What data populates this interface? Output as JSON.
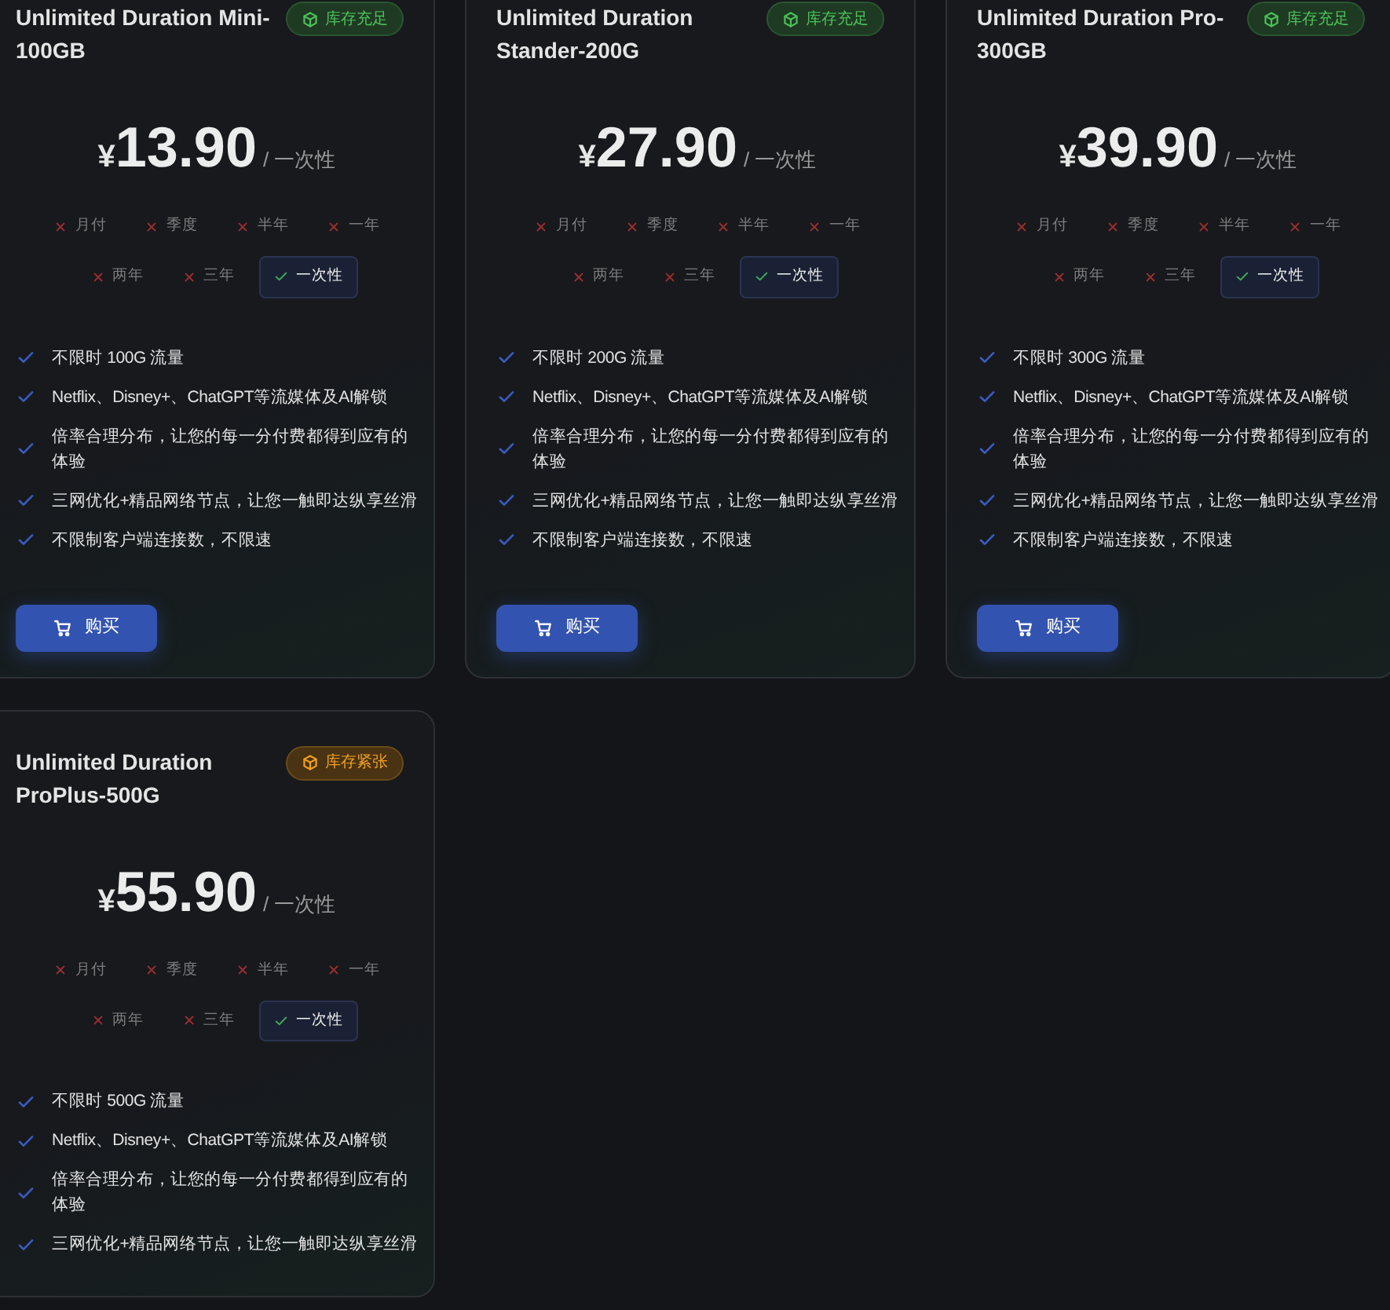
{
  "plans": [
    {
      "title": "Unlimited Duration Mini-100GB",
      "stock": {
        "kind": "ample",
        "label": "库存充足"
      },
      "currency": "¥",
      "price": "13.90",
      "per": "/ 一次性",
      "periods": [
        {
          "label": "月付",
          "available": false,
          "selected": false
        },
        {
          "label": "季度",
          "available": false,
          "selected": false
        },
        {
          "label": "半年",
          "available": false,
          "selected": false
        },
        {
          "label": "一年",
          "available": false,
          "selected": false
        },
        {
          "label": "两年",
          "available": false,
          "selected": false
        },
        {
          "label": "三年",
          "available": false,
          "selected": false
        },
        {
          "label": "一次性",
          "available": true,
          "selected": true
        }
      ],
      "features": [
        "不限时 100G 流量",
        "Netflix、Disney+、ChatGPT等流媒体及AI解锁",
        "倍率合理分布，让您的每一分付费都得到应有的体验",
        "三网优化+精品网络节点，让您一触即达纵享丝滑",
        "不限制客户端连接数，不限速"
      ],
      "button": "购买"
    },
    {
      "title": "Unlimited Duration Stander-200G",
      "stock": {
        "kind": "ample",
        "label": "库存充足"
      },
      "currency": "¥",
      "price": "27.90",
      "per": "/ 一次性",
      "periods": [
        {
          "label": "月付",
          "available": false,
          "selected": false
        },
        {
          "label": "季度",
          "available": false,
          "selected": false
        },
        {
          "label": "半年",
          "available": false,
          "selected": false
        },
        {
          "label": "一年",
          "available": false,
          "selected": false
        },
        {
          "label": "两年",
          "available": false,
          "selected": false
        },
        {
          "label": "三年",
          "available": false,
          "selected": false
        },
        {
          "label": "一次性",
          "available": true,
          "selected": true
        }
      ],
      "features": [
        "不限时 200G 流量",
        "Netflix、Disney+、ChatGPT等流媒体及AI解锁",
        "倍率合理分布，让您的每一分付费都得到应有的体验",
        "三网优化+精品网络节点，让您一触即达纵享丝滑",
        "不限制客户端连接数，不限速"
      ],
      "button": "购买"
    },
    {
      "title": "Unlimited Duration Pro-300GB",
      "stock": {
        "kind": "ample",
        "label": "库存充足"
      },
      "currency": "¥",
      "price": "39.90",
      "per": "/ 一次性",
      "periods": [
        {
          "label": "月付",
          "available": false,
          "selected": false
        },
        {
          "label": "季度",
          "available": false,
          "selected": false
        },
        {
          "label": "半年",
          "available": false,
          "selected": false
        },
        {
          "label": "一年",
          "available": false,
          "selected": false
        },
        {
          "label": "两年",
          "available": false,
          "selected": false
        },
        {
          "label": "三年",
          "available": false,
          "selected": false
        },
        {
          "label": "一次性",
          "available": true,
          "selected": true
        }
      ],
      "features": [
        "不限时 300G 流量",
        "Netflix、Disney+、ChatGPT等流媒体及AI解锁",
        "倍率合理分布，让您的每一分付费都得到应有的体验",
        "三网优化+精品网络节点，让您一触即达纵享丝滑",
        "不限制客户端连接数，不限速"
      ],
      "button": "购买"
    },
    {
      "title": "Unlimited Duration ProPlus-500G",
      "stock": {
        "kind": "low",
        "label": "库存紧张"
      },
      "currency": "¥",
      "price": "55.90",
      "per": "/ 一次性",
      "periods": [
        {
          "label": "月付",
          "available": false,
          "selected": false
        },
        {
          "label": "季度",
          "available": false,
          "selected": false
        },
        {
          "label": "半年",
          "available": false,
          "selected": false
        },
        {
          "label": "一年",
          "available": false,
          "selected": false
        },
        {
          "label": "两年",
          "available": false,
          "selected": false
        },
        {
          "label": "三年",
          "available": false,
          "selected": false
        },
        {
          "label": "一次性",
          "available": true,
          "selected": true
        }
      ],
      "features": [
        "不限时 500G 流量",
        "Netflix、Disney+、ChatGPT等流媒体及AI解锁",
        "倍率合理分布，让您的每一分付费都得到应有的体验",
        "三网优化+精品网络节点，让您一触即达纵享丝滑"
      ]
    }
  ]
}
